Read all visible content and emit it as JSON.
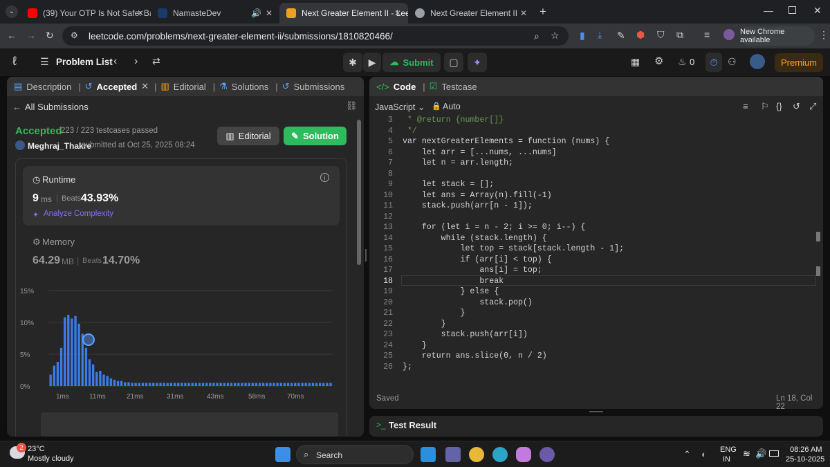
{
  "browser": {
    "tabs": [
      {
        "title": "(39) Your OTP Is Not Safe: Bank",
        "favicon_color": "#ff0000"
      },
      {
        "title": "NamasteDev",
        "favicon_color": "#1a3a6b"
      },
      {
        "title": "Next Greater Element II - LeetC",
        "favicon_color": "#f0a020"
      },
      {
        "title": "Next Greater Element II",
        "favicon_color": "#9aa0a6"
      }
    ],
    "new_tab": "+",
    "url": "leetcode.com/problems/next-greater-element-ii/submissions/1810820466/",
    "update_label": "New Chrome available"
  },
  "header": {
    "problem_list": "Problem List",
    "submit": "Submit",
    "premium": "Premium",
    "streak": "0"
  },
  "left": {
    "tabs": {
      "description": "Description",
      "accepted": "Accepted",
      "editorial": "Editorial",
      "solutions": "Solutions",
      "submissions": "Submissions"
    },
    "all_submissions": "All Submissions",
    "status": "Accepted",
    "testcases": "223 / 223 testcases passed",
    "user": "Meghraj_Thakre",
    "submitted": "submitted at Oct 25, 2025 08:24",
    "editorial_btn": "Editorial",
    "solution_btn": "Solution",
    "runtime": {
      "label": "Runtime",
      "value": "9",
      "unit": "ms",
      "beats_label": "Beats",
      "beats": "43.93%",
      "analyze": "Analyze Complexity"
    },
    "memory": {
      "label": "Memory",
      "value": "64.29",
      "unit": "MB",
      "beats_label": "Beats",
      "beats": "14.70%"
    }
  },
  "chart_data": {
    "type": "bar",
    "y_ticks": [
      "15%",
      "10%",
      "5%",
      "0%"
    ],
    "x_ticks": [
      "1ms",
      "11ms",
      "21ms",
      "31ms",
      "43ms",
      "58ms",
      "70ms"
    ],
    "ylim": [
      0,
      15
    ],
    "values": [
      1.8,
      3.2,
      3.8,
      6.0,
      10.8,
      11.2,
      10.6,
      11.0,
      9.8,
      8.2,
      6.0,
      4.2,
      3.4,
      2.2,
      2.4,
      1.8,
      1.6,
      1.2,
      1.0,
      0.8,
      0.8,
      0.6,
      0.6,
      0.5,
      0.5,
      0.5,
      0.5,
      0.5,
      0.5,
      0.5,
      0.5,
      0.5,
      0.5,
      0.5,
      0.5,
      0.5,
      0.5,
      0.5,
      0.5,
      0.5,
      0.5,
      0.5,
      0.5,
      0.5,
      0.5,
      0.5,
      0.5,
      0.5,
      0.5,
      0.5,
      0.5,
      0.5,
      0.5,
      0.5,
      0.5,
      0.5,
      0.5,
      0.5,
      0.5,
      0.5,
      0.5,
      0.5,
      0.5,
      0.5,
      0.5,
      0.5,
      0.5,
      0.5,
      0.5,
      0.5,
      0.5,
      0.5,
      0.5,
      0.5,
      0.5,
      0.5,
      0.5,
      0.5,
      0.5,
      0.5
    ],
    "color": "#3d7be8"
  },
  "right": {
    "code_tab": "Code",
    "testcase_tab": "Testcase",
    "language": "JavaScript",
    "auto": "Auto",
    "saved": "Saved",
    "cursor": "Ln 18, Col 22",
    "test_result": "Test Result"
  },
  "code_lines": [
    {
      "n": "3",
      "t": " * @return {number[]}"
    },
    {
      "n": "4",
      "t": " */"
    },
    {
      "n": "5",
      "t": "var nextGreaterElements = function (nums) {"
    },
    {
      "n": "6",
      "t": "    let arr = [...nums, ...nums]"
    },
    {
      "n": "7",
      "t": "    let n = arr.length;"
    },
    {
      "n": "8",
      "t": ""
    },
    {
      "n": "9",
      "t": "    let stack = [];"
    },
    {
      "n": "10",
      "t": "    let ans = Array(n).fill(-1)"
    },
    {
      "n": "11",
      "t": "    stack.push(arr[n - 1]);"
    },
    {
      "n": "12",
      "t": ""
    },
    {
      "n": "13",
      "t": "    for (let i = n - 2; i >= 0; i--) {"
    },
    {
      "n": "14",
      "t": "        while (stack.length) {"
    },
    {
      "n": "15",
      "t": "            let top = stack[stack.length - 1];"
    },
    {
      "n": "16",
      "t": "            if (arr[i] < top) {"
    },
    {
      "n": "17",
      "t": "                ans[i] = top;"
    },
    {
      "n": "18",
      "t": "                break"
    },
    {
      "n": "19",
      "t": "            } else {"
    },
    {
      "n": "20",
      "t": "                stack.pop()"
    },
    {
      "n": "21",
      "t": "            }"
    },
    {
      "n": "22",
      "t": "        }"
    },
    {
      "n": "23",
      "t": "        stack.push(arr[i])"
    },
    {
      "n": "24",
      "t": "    }"
    },
    {
      "n": "25",
      "t": "    return ans.slice(0, n / 2)"
    },
    {
      "n": "26",
      "t": "};"
    }
  ],
  "taskbar": {
    "temp": "23°C",
    "weather": "Mostly cloudy",
    "badge": "2",
    "search": "Search",
    "lang1": "ENG",
    "lang2": "IN",
    "time": "08:26 AM",
    "date": "25-10-2025"
  },
  "colors": {
    "accent": "#2cbb5d",
    "premium": "#ffa116"
  }
}
